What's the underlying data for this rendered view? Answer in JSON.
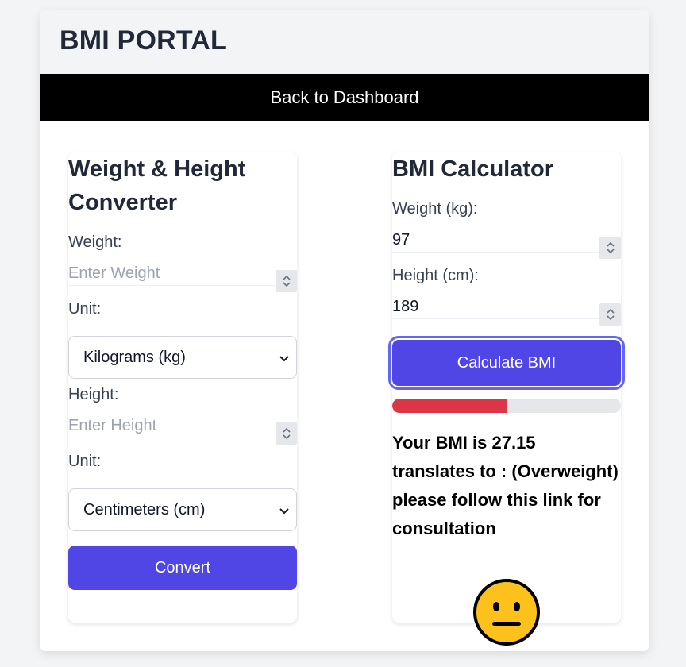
{
  "header": {
    "title": "BMI PORTAL"
  },
  "nav": {
    "back_label": "Back to Dashboard"
  },
  "converter": {
    "title": "Weight & Height Converter",
    "weight_label": "Weight:",
    "weight_value": "",
    "weight_placeholder": "Enter Weight",
    "weight_unit_label": "Unit:",
    "weight_unit_selected": "Kilograms (kg)",
    "height_label": "Height:",
    "height_value": "",
    "height_placeholder": "Enter Height",
    "height_unit_label": "Unit:",
    "height_unit_selected": "Centimeters (cm)",
    "convert_label": "Convert"
  },
  "calculator": {
    "title": "BMI Calculator",
    "weight_label": "Weight (kg):",
    "weight_value": "97",
    "height_label": "Height (cm):",
    "height_value": "189",
    "calculate_label": "Calculate BMI",
    "bmi_progress_fraction": 0.5,
    "bmi_progress_color": "#dc3545",
    "result_text": "Your BMI is 27.15 translates to : (Overweight) please follow this link for consultation",
    "result_icon": "neutral-face-emoji"
  },
  "colors": {
    "accent": "#4f46e5",
    "header_bar": "#000000",
    "page_bg": "#f3f4f6"
  }
}
